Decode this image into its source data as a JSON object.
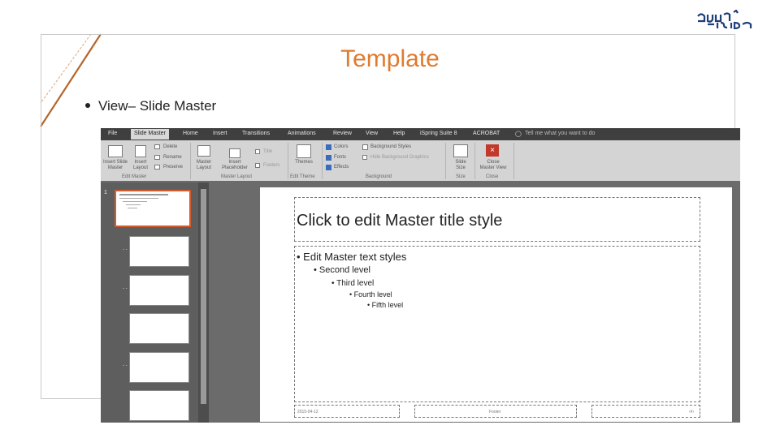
{
  "slide": {
    "title": "Template",
    "bullet": "View– Slide Master",
    "accent_color": "#e07a2e"
  },
  "logo": {
    "alt": "logo"
  },
  "ribbon": {
    "tabs": [
      "File",
      "Slide Master",
      "Home",
      "Insert",
      "Transitions",
      "Animations",
      "Review",
      "View",
      "Help",
      "iSpring Suite 8",
      "ACROBAT"
    ],
    "active_tab": "Slide Master",
    "tell_me": "Tell me what you want to do",
    "buttons": {
      "insert_slide_master_1": "Insert Slide",
      "insert_slide_master_2": "Master",
      "insert_layout_1": "Insert",
      "insert_layout_2": "Layout",
      "delete": "Delete",
      "rename": "Rename",
      "preserve": "Preserve",
      "master_layout_1": "Master",
      "master_layout_2": "Layout",
      "insert_placeholder_1": "Insert",
      "insert_placeholder_2": "Placeholder",
      "title": "Title",
      "footers": "Footers",
      "themes": "Themes",
      "colors": "Colors",
      "fonts": "Fonts",
      "effects": "Effects",
      "background_styles": "Background Styles",
      "hide_background_graphics": "Hide Background Graphics",
      "slide_size_1": "Slide",
      "slide_size_2": "Size",
      "close_master_view_1": "Close",
      "close_master_view_2": "Master View"
    },
    "groups": {
      "edit_master": "Edit Master",
      "master_layout": "Master Layout",
      "edit_theme": "Edit Theme",
      "background": "Background",
      "size": "Size",
      "close": "Close"
    }
  },
  "thumbnails": {
    "first_number": "1"
  },
  "master": {
    "title": "Click to edit Master title style",
    "level1": "Edit Master text styles",
    "level2": "Second level",
    "level3": "Third level",
    "level4": "Fourth level",
    "level5": "Fifth level",
    "footer_date": "2015-04-12",
    "footer_text": "Footer",
    "footer_num": "‹#›"
  }
}
